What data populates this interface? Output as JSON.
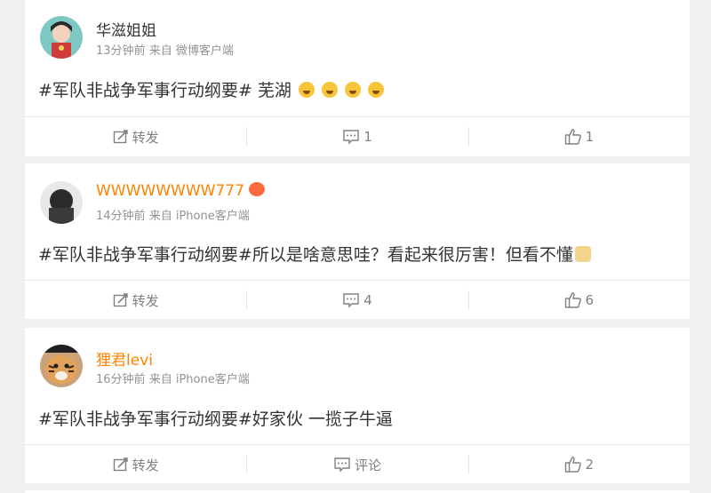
{
  "posts": [
    {
      "username": "华滋姐姐",
      "time": "13分钟前",
      "source_prefix": "来自",
      "source": "微博客户端",
      "text": "#军队非战争军事行动纲要# 芜湖",
      "emojis": [
        "scream-emoji",
        "scream-emoji",
        "scream-emoji",
        "scream-emoji"
      ],
      "repost_label": "转发",
      "comment_label": "1",
      "like_label": "1"
    },
    {
      "username": "WWWWWWWW777",
      "time": "14分钟前",
      "source_prefix": "来自",
      "source": "iPhone客户端",
      "text": "#军队非战争军事行动纲要#所以是啥意思哇？看起来很厉害！但看不懂",
      "repost_label": "转发",
      "comment_label": "4",
      "like_label": "6"
    },
    {
      "username": "狸君levi",
      "time": "16分钟前",
      "source_prefix": "来自",
      "source": "iPhone客户端",
      "text": "#军队非战争军事行动纲要#好家伙 一揽子牛逼",
      "repost_label": "转发",
      "comment_label": "评论",
      "like_label": "2"
    }
  ],
  "colors": {
    "accent_orange": "#ff8200",
    "meta_gray": "#939393",
    "action_gray": "#808080",
    "background": "#f0f0f0"
  }
}
